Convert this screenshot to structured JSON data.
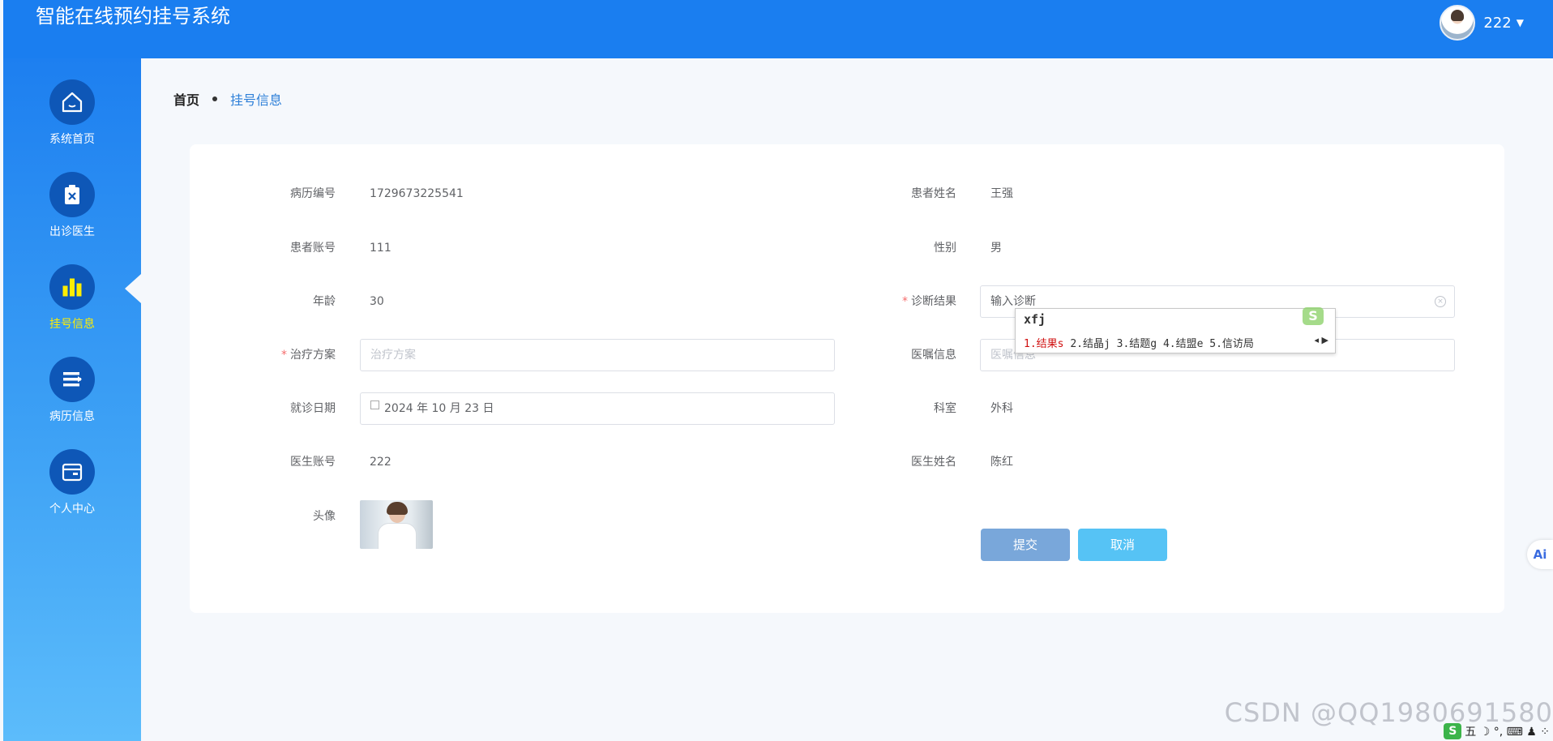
{
  "app": {
    "title": "智能在线预约挂号系统"
  },
  "user": {
    "name": "222"
  },
  "sidebar": {
    "items": [
      {
        "label": "系统首页",
        "icon": "home-icon"
      },
      {
        "label": "出诊医生",
        "icon": "clipboard-x-icon"
      },
      {
        "label": "挂号信息",
        "icon": "bar-chart-icon",
        "active": true
      },
      {
        "label": "病历信息",
        "icon": "list-icon"
      },
      {
        "label": "个人中心",
        "icon": "wallet-icon"
      }
    ]
  },
  "breadcrumb": {
    "home": "首页",
    "current": "挂号信息"
  },
  "form": {
    "record_no": {
      "label": "病历编号",
      "value": "1729673225541"
    },
    "patient_name": {
      "label": "患者姓名",
      "value": "王强"
    },
    "patient_account": {
      "label": "患者账号",
      "value": "111"
    },
    "gender": {
      "label": "性别",
      "value": "男"
    },
    "age": {
      "label": "年龄",
      "value": "30"
    },
    "diagnosis": {
      "label": "诊断结果",
      "value": "输入诊断"
    },
    "treatment": {
      "label": "治疗方案",
      "placeholder": "治疗方案"
    },
    "advice": {
      "label": "医嘱信息",
      "placeholder": "医嘱信息"
    },
    "visit_date": {
      "label": "就诊日期",
      "value": "2024 年 10 月 23 日"
    },
    "department": {
      "label": "科室",
      "value": "外科"
    },
    "doctor_account": {
      "label": "医生账号",
      "value": "222"
    },
    "doctor_name": {
      "label": "医生姓名",
      "value": "陈红"
    },
    "avatar": {
      "label": "头像"
    }
  },
  "buttons": {
    "submit": "提交",
    "cancel": "取消"
  },
  "ime": {
    "composition": "xfj",
    "candidates": [
      "1.结果s",
      "2.结晶j",
      "3.结题g",
      "4.结盟e",
      "5.信访局"
    ],
    "badge": "S"
  },
  "ai_button": "Ai",
  "watermark": "CSDN @QQ1980691580",
  "tray": {
    "logo": "S",
    "text": "五 ☽ °, ⌨ ♟ ⁘"
  },
  "colors": {
    "header": "#1a7ef0",
    "active_nav": "#ffee00",
    "required": "#f56c6c",
    "submit": "#79a7da",
    "cancel": "#56c3f5"
  }
}
